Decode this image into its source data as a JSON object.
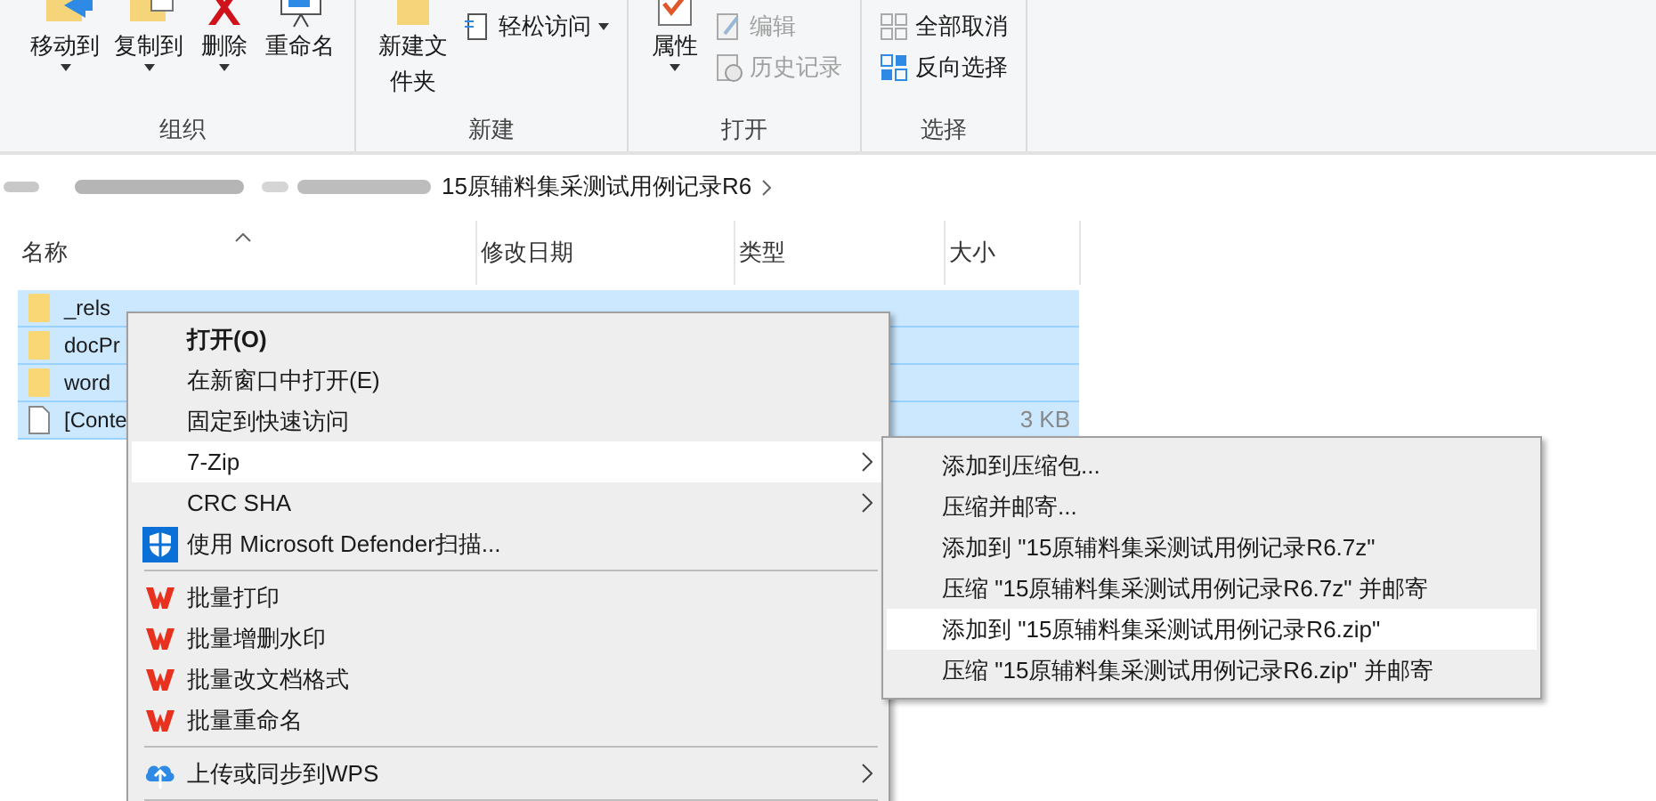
{
  "ribbon": {
    "groups": [
      {
        "label": "组织",
        "commands": [
          {
            "kind": "large",
            "label": "移动到",
            "dropdown": true,
            "disabled": false
          },
          {
            "kind": "large",
            "label": "复制到",
            "dropdown": true,
            "disabled": false
          },
          {
            "kind": "large",
            "label": "删除",
            "dropdown": true,
            "disabled": false
          },
          {
            "kind": "large",
            "label": "重命名",
            "dropdown": false,
            "disabled": false
          }
        ]
      },
      {
        "label": "新建",
        "commands": [
          {
            "kind": "large",
            "label": "新建文件夹",
            "dropdown": false,
            "disabled": false
          },
          {
            "kind": "small",
            "label": "轻松访问",
            "dropdown": true,
            "disabled": false
          }
        ]
      },
      {
        "label": "打开",
        "commands": [
          {
            "kind": "large",
            "label": "属性",
            "dropdown": true,
            "disabled": false
          },
          {
            "kind": "small",
            "label": "编辑",
            "dropdown": false,
            "disabled": true
          },
          {
            "kind": "small",
            "label": "历史记录",
            "dropdown": false,
            "disabled": true
          }
        ]
      },
      {
        "label": "选择",
        "commands": [
          {
            "kind": "small",
            "label": "全部取消",
            "dropdown": false,
            "disabled": false
          },
          {
            "kind": "small",
            "label": "反向选择",
            "dropdown": false,
            "disabled": false
          }
        ]
      }
    ]
  },
  "breadcrumb": {
    "current": "15原辅料集采测试用例记录R6"
  },
  "columns": [
    "名称",
    "修改日期",
    "类型",
    "大小"
  ],
  "rows": [
    {
      "kind": "folder",
      "name": "_rels",
      "size": "",
      "selected": true
    },
    {
      "kind": "folder",
      "name": "docPr",
      "size": "",
      "selected": true
    },
    {
      "kind": "folder",
      "name": "word",
      "size": "",
      "selected": true
    },
    {
      "kind": "file",
      "name": "[Conte",
      "size": "3 KB",
      "selected": true
    }
  ],
  "context_menu": {
    "items": [
      {
        "kind": "plain",
        "label": "打开(O)",
        "bold": true,
        "submenu": false,
        "highlighted": false
      },
      {
        "kind": "plain",
        "label": "在新窗口中打开(E)",
        "bold": false,
        "submenu": false,
        "highlighted": false
      },
      {
        "kind": "plain",
        "label": "固定到快速访问",
        "bold": false,
        "submenu": false,
        "highlighted": false
      },
      {
        "kind": "plain",
        "label": "7-Zip",
        "bold": false,
        "submenu": true,
        "highlighted": true
      },
      {
        "kind": "plain",
        "label": "CRC SHA",
        "bold": false,
        "submenu": true,
        "highlighted": false
      },
      {
        "kind": "defender",
        "label": "使用 Microsoft Defender扫描...",
        "bold": false,
        "submenu": false,
        "highlighted": false
      },
      {
        "kind": "separator"
      },
      {
        "kind": "wps",
        "label": "批量打印",
        "bold": false,
        "submenu": false,
        "highlighted": false
      },
      {
        "kind": "wps",
        "label": "批量增删水印",
        "bold": false,
        "submenu": false,
        "highlighted": false
      },
      {
        "kind": "wps",
        "label": "批量改文档格式",
        "bold": false,
        "submenu": false,
        "highlighted": false
      },
      {
        "kind": "wps",
        "label": "批量重命名",
        "bold": false,
        "submenu": false,
        "highlighted": false
      },
      {
        "kind": "separator"
      },
      {
        "kind": "cloud",
        "label": "上传或同步到WPS",
        "bold": false,
        "submenu": true,
        "highlighted": false
      },
      {
        "kind": "separator"
      }
    ]
  },
  "submenu": {
    "items": [
      {
        "label": "添加到压缩包...",
        "highlighted": false
      },
      {
        "label": "压缩并邮寄...",
        "highlighted": false
      },
      {
        "label": "添加到 \"15原辅料集采测试用例记录R6.7z\"",
        "highlighted": false
      },
      {
        "label": "压缩 \"15原辅料集采测试用例记录R6.7z\" 并邮寄",
        "highlighted": false
      },
      {
        "label": "添加到 \"15原辅料集采测试用例记录R6.zip\"",
        "highlighted": true
      },
      {
        "label": "压缩 \"15原辅料集采测试用例记录R6.zip\" 并邮寄",
        "highlighted": false
      }
    ]
  }
}
